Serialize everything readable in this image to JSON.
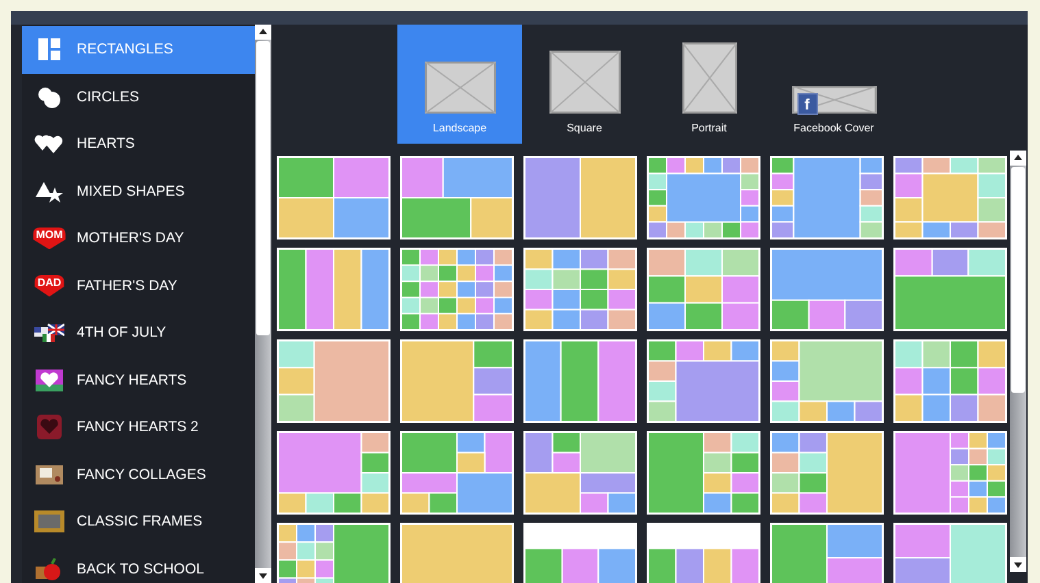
{
  "sidebar": {
    "items": [
      {
        "label": "RECTANGLES",
        "selected": true
      },
      {
        "label": "CIRCLES",
        "selected": false
      },
      {
        "label": "HEARTS",
        "selected": false
      },
      {
        "label": "MIXED SHAPES",
        "selected": false
      },
      {
        "label": "MOTHER'S DAY",
        "selected": false,
        "badge": "MOM"
      },
      {
        "label": "FATHER'S DAY",
        "selected": false,
        "badge": "DAD"
      },
      {
        "label": "4TH OF JULY",
        "selected": false
      },
      {
        "label": "FANCY HEARTS",
        "selected": false
      },
      {
        "label": "FANCY HEARTS 2",
        "selected": false
      },
      {
        "label": "FANCY COLLAGES",
        "selected": false
      },
      {
        "label": "CLASSIC FRAMES",
        "selected": false
      },
      {
        "label": "BACK TO SCHOOL",
        "selected": false
      }
    ]
  },
  "formats": [
    {
      "label": "Landscape",
      "selected": true
    },
    {
      "label": "Square",
      "selected": false
    },
    {
      "label": "Portrait",
      "selected": false
    },
    {
      "label": "Facebook Cover",
      "selected": false,
      "badge": "f"
    }
  ]
}
